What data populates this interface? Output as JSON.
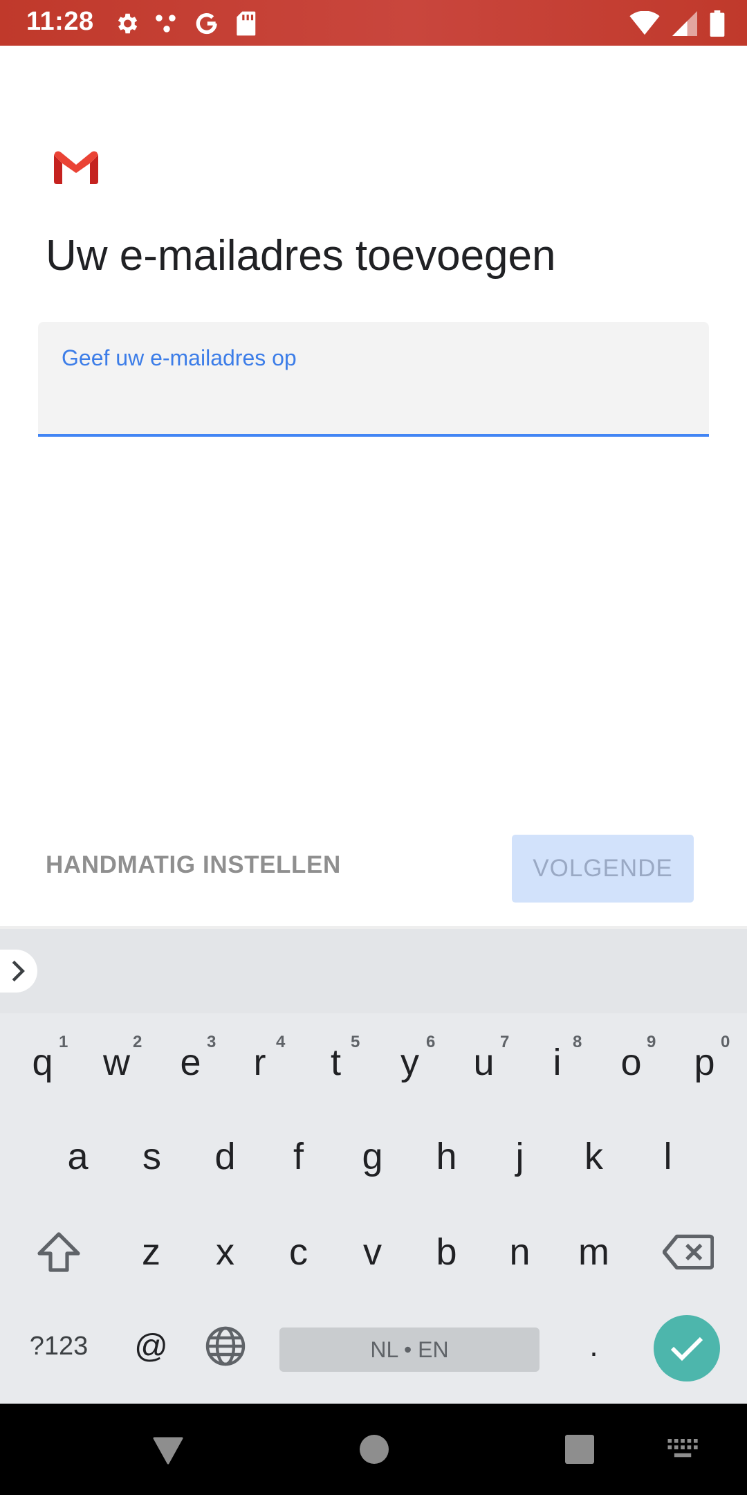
{
  "status_bar": {
    "time": "11:28",
    "left_icons": [
      "settings-gear-icon",
      "dots-network-icon",
      "google-g-icon",
      "sd-card-icon"
    ],
    "right_icons": [
      "wifi-icon",
      "cell-signal-icon",
      "battery-icon"
    ]
  },
  "header": {
    "logo": "gmail-logo",
    "title": "Uw e-mailadres toevoegen"
  },
  "email_field": {
    "label": "Geef uw e-mailadres op",
    "value": "",
    "accent_color": "#4285f4"
  },
  "actions": {
    "manual_setup_label": "HANDMATIG INSTELLEN",
    "next_label": "VOLGENDE",
    "next_enabled": false
  },
  "keyboard": {
    "row1": [
      {
        "key": "q",
        "hint": "1"
      },
      {
        "key": "w",
        "hint": "2"
      },
      {
        "key": "e",
        "hint": "3"
      },
      {
        "key": "r",
        "hint": "4"
      },
      {
        "key": "t",
        "hint": "5"
      },
      {
        "key": "y",
        "hint": "6"
      },
      {
        "key": "u",
        "hint": "7"
      },
      {
        "key": "i",
        "hint": "8"
      },
      {
        "key": "o",
        "hint": "9"
      },
      {
        "key": "p",
        "hint": "0"
      }
    ],
    "row2": [
      "a",
      "s",
      "d",
      "f",
      "g",
      "h",
      "j",
      "k",
      "l"
    ],
    "row3": [
      "z",
      "x",
      "c",
      "v",
      "b",
      "n",
      "m"
    ],
    "symbols_label": "?123",
    "at_label": "@",
    "space_label": "NL • EN",
    "period_label": ".",
    "enter_color": "#4db6ac"
  },
  "nav_bar": {
    "buttons": [
      "back-triangle-icon",
      "home-circle-icon",
      "recents-square-icon",
      "keyboard-switch-icon"
    ]
  }
}
